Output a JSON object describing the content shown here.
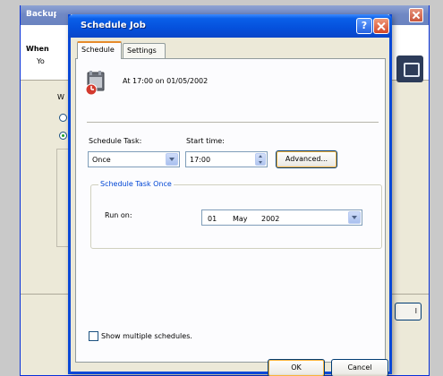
{
  "background_window": {
    "title": "Backup",
    "header_title": "When",
    "header_subtitle": "Yo",
    "body_label": "W",
    "right_button_label": "l"
  },
  "dialog": {
    "title": "Schedule Job",
    "help_label": "?",
    "tabs": [
      {
        "label": "Schedule",
        "active": true
      },
      {
        "label": "Settings",
        "active": false
      }
    ],
    "summary": "At 17:00 on 01/05/2002",
    "schedule_task_label": "Schedule Task:",
    "schedule_task_value": "Once",
    "start_time_label": "Start time:",
    "start_time_value": "17:00",
    "advanced_label": "Advanced...",
    "group_title": "Schedule Task Once",
    "run_on_label": "Run on:",
    "run_on_date": {
      "day": "01",
      "month": "May",
      "year": "2002"
    },
    "show_multiple_label": "Show multiple schedules.",
    "show_multiple_checked": false,
    "ok_label": "OK",
    "cancel_label": "Cancel"
  },
  "colors": {
    "titlebar": "#0550dc",
    "dialog_face": "#ece9d8",
    "group_title": "#0046d5",
    "active_tab_accent": "#e68b2c"
  }
}
